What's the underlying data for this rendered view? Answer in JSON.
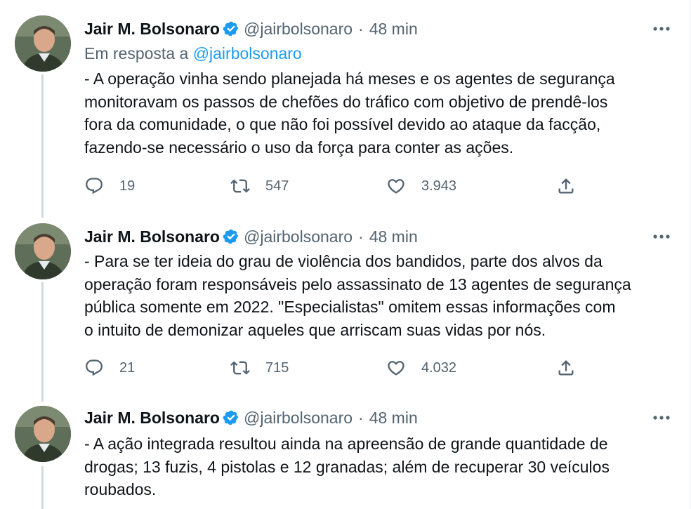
{
  "tweets": [
    {
      "author_name": "Jair M. Bolsonaro",
      "handle": "@jairbolsonaro",
      "separator": "·",
      "time": "48 min",
      "reply_prefix": "Em resposta a ",
      "reply_mention": "@jairbolsonaro",
      "text": "- A operação vinha sendo planejada há meses e os agentes de segurança\nmonitoravam os passos de chefões do tráfico com objetivo de prendê-los\nfora da comunidade, o que não foi possível devido ao ataque da facção,\nfazendo-se necessário o uso da força para conter as ações.",
      "replies": "19",
      "retweets": "547",
      "likes": "3.943"
    },
    {
      "author_name": "Jair M. Bolsonaro",
      "handle": "@jairbolsonaro",
      "separator": "·",
      "time": "48 min",
      "text": "- Para se ter ideia do grau de violência dos bandidos, parte dos alvos da\noperação foram responsáveis pelo assassinato de 13 agentes de segurança\npública somente em 2022. \"Especialistas\" omitem essas informações com\no intuito de demonizar aqueles que arriscam suas vidas por nós.",
      "replies": "21",
      "retweets": "715",
      "likes": "4.032"
    },
    {
      "author_name": "Jair M. Bolsonaro",
      "handle": "@jairbolsonaro",
      "separator": "·",
      "time": "48 min",
      "text": "- A ação integrada resultou ainda na apreensão de grande quantidade de\ndrogas; 13 fuzis, 4 pistolas e 12 granadas; além de recuperar 30 veículos\nroubados."
    }
  ],
  "colors": {
    "text": "#0f1419",
    "secondary": "#536471",
    "accent": "#1d9bf0",
    "thread_line": "#cfd9de"
  },
  "icons": [
    "verified-badge-icon",
    "more-options-icon",
    "reply-icon",
    "retweet-icon",
    "like-icon",
    "share-icon"
  ]
}
